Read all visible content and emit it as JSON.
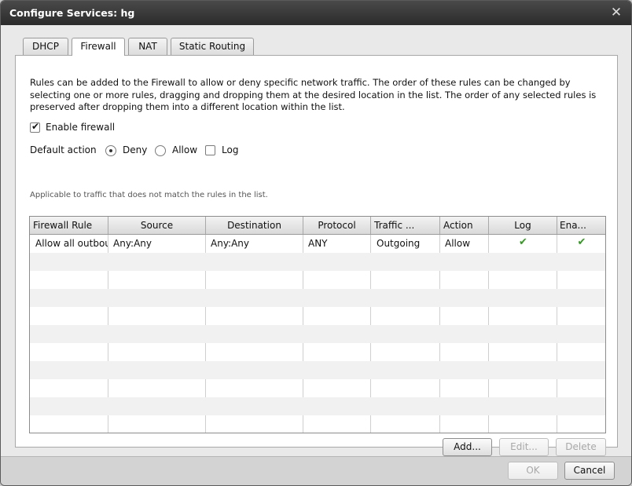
{
  "window": {
    "title": "Configure Services: hg",
    "close_glyph": "✕"
  },
  "tabs": [
    {
      "label": "DHCP",
      "active": false
    },
    {
      "label": "Firewall",
      "active": true
    },
    {
      "label": "NAT",
      "active": false
    },
    {
      "label": "Static Routing",
      "active": false
    }
  ],
  "firewall": {
    "description": "Rules can be added to the Firewall to allow or deny specific network traffic. The order of these rules can be changed by selecting one or more rules, dragging and dropping them at the desired location in the list. The order of any selected rules is preserved after dropping them into a different location within the list.",
    "enable_label": "Enable firewall",
    "enable_checked": true,
    "default_action_label": "Default action",
    "deny_label": "Deny",
    "deny_selected": true,
    "allow_label": "Allow",
    "allow_selected": false,
    "log_label": "Log",
    "log_checked": false,
    "hint": "Applicable to traffic that does not match the rules in the list."
  },
  "grid": {
    "columns": [
      "Firewall Rule",
      "Source",
      "Destination",
      "Protocol",
      "Traffic ...",
      "Action",
      "Log",
      "Ena..."
    ],
    "rows": [
      {
        "rule": "Allow all outbou",
        "source": "Any:Any",
        "destination": "Any:Any",
        "protocol": "ANY",
        "traffic": "Outgoing",
        "action": "Allow",
        "log": "✔",
        "enabled": "✔"
      }
    ]
  },
  "buttons": {
    "add": "Add...",
    "edit": "Edit...",
    "delete": "Delete",
    "ok": "OK",
    "cancel": "Cancel"
  },
  "icons": {
    "close": "close-icon",
    "check": "checkmark-icon"
  },
  "colors": {
    "check_green": "#2f9b1c",
    "titlebar": "#333333"
  }
}
